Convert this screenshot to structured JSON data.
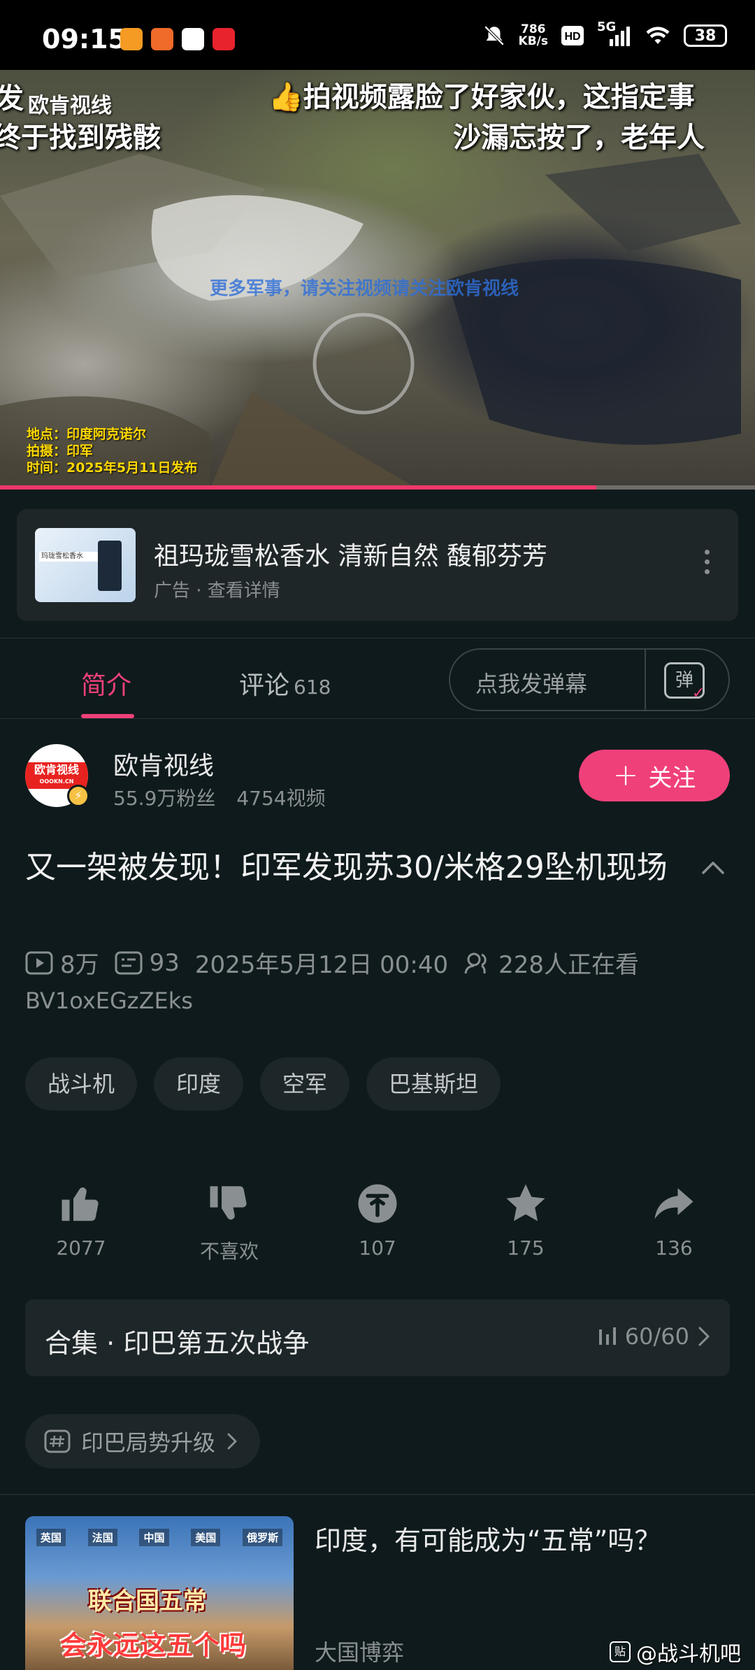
{
  "status_bar": {
    "time": "09:15",
    "speed_value": "786",
    "speed_unit": "KB/s",
    "network": "5G",
    "battery": "38",
    "app_icon_colors": [
      "#f59b23",
      "#f06a2a",
      "#ffffff",
      "#e8232d"
    ]
  },
  "video": {
    "channel_watermark": "欧肯视线",
    "caption_left_1": "发",
    "caption_left_2": "终于找到残骸",
    "caption_right_1": "👍拍视频露脸了好家伙，这指定事",
    "caption_right_2": "沙漏忘按了，老年人",
    "center_watermark": "更多军事，请关注视频请关注欧肯视线",
    "location": "地点：印度阿克诺尔",
    "shot_by": "拍摄：印军",
    "date": "时间：2025年5月11日发布",
    "progress": 0.79,
    "accent_color": "#f0386b"
  },
  "ad": {
    "thumb_label": "玛珑雪松香水",
    "title": "祖玛珑雪松香水 清新自然 馥郁芬芳",
    "subtitle": "广告 · 查看详情"
  },
  "tabs": {
    "intro": "简介",
    "comments": "评论",
    "comments_count": "618",
    "danmaku_placeholder": "点我发弹幕",
    "danmaku_icon_char": "弹"
  },
  "author": {
    "avatar_text": "欧肯视线",
    "avatar_subtext": "OOOKN.CN",
    "name": "欧肯视线",
    "fans": "55.9万粉丝",
    "videos": "4754视频",
    "follow_label": "关注",
    "follow_color": "#f0407a"
  },
  "video_info": {
    "title": "又一架被发现！印军发现苏30/米格29坠机现场",
    "views": "8万",
    "danmaku_count": "93",
    "published": "2025年5月12日 00:40",
    "watching": "228人正在看",
    "bvid": "BV1oxEGzZEks"
  },
  "tags": [
    "战斗机",
    "印度",
    "空军",
    "巴基斯坦"
  ],
  "actions": {
    "like": "2077",
    "dislike": "不喜欢",
    "coin": "107",
    "favorite": "175",
    "share": "136"
  },
  "collection": {
    "title": "合集 · 印巴第五次战争",
    "progress": "60/60"
  },
  "topic": {
    "label": "印巴局势升级"
  },
  "recommendation": {
    "flags": [
      "英国",
      "法国",
      "中国",
      "美国",
      "俄罗斯"
    ],
    "overlay_1": "联合国五常",
    "overlay_2": "会永远这五个吗",
    "title": "印度，有可能成为“五常”吗？",
    "author": "大国博弈"
  },
  "bottom_watermark": {
    "icon_char": "贴",
    "text": "@战斗机吧"
  }
}
